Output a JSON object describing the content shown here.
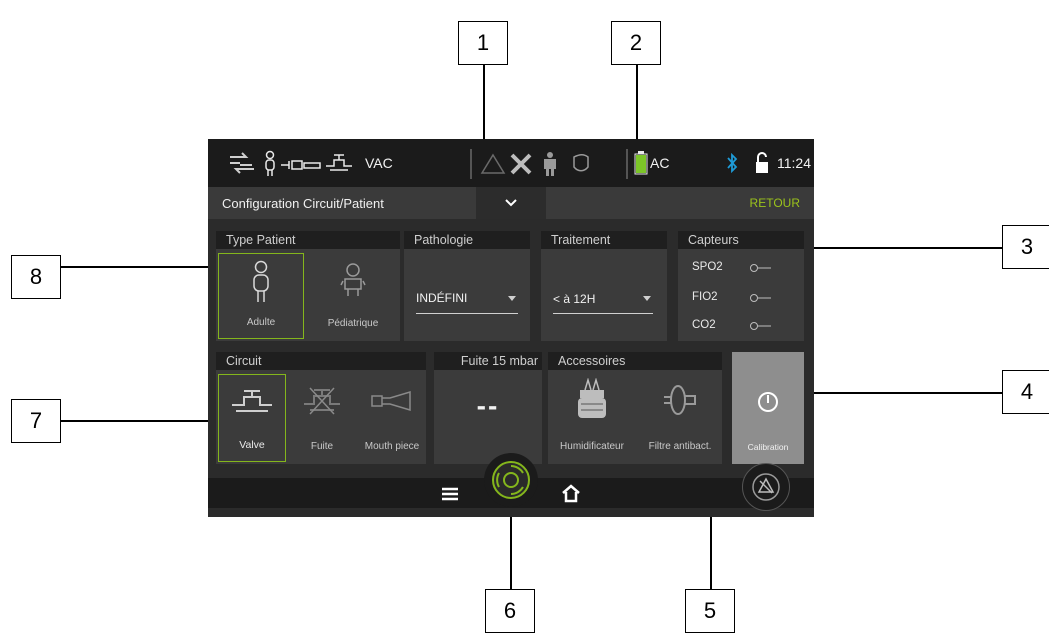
{
  "callouts": [
    "1",
    "2",
    "3",
    "4",
    "5",
    "6",
    "7",
    "8"
  ],
  "statusbar": {
    "mode_label": "VAC",
    "power_label": "AC",
    "time": "11:24",
    "icons": [
      "ventilation-mode-icon",
      "patient-icon",
      "circuit-icon",
      "valve-icon",
      "alarm-icon",
      "tools-icon",
      "person-icon",
      "mask-icon",
      "battery-icon",
      "bluetooth-icon",
      "lock-icon"
    ]
  },
  "header": {
    "title": "Configuration Circuit/Patient",
    "back_label": "RETOUR"
  },
  "patient_type": {
    "title": "Type Patient",
    "options": [
      {
        "label": "Adulte",
        "icon": "adult-icon",
        "selected": true
      },
      {
        "label": "Pédiatrique",
        "icon": "baby-icon",
        "selected": false
      }
    ]
  },
  "pathology": {
    "title": "Pathologie",
    "value": "INDÉFINI"
  },
  "treatment": {
    "title": "Traitement",
    "value": "< à 12H"
  },
  "sensors": {
    "title": "Capteurs",
    "items": [
      {
        "label": "SPO2",
        "on": false
      },
      {
        "label": "FIO2",
        "on": false
      },
      {
        "label": "CO2",
        "on": false
      }
    ]
  },
  "circuit": {
    "title": "Circuit",
    "options": [
      {
        "label": "Valve",
        "icon": "valve-circuit-icon",
        "selected": true
      },
      {
        "label": "Fuite",
        "icon": "leak-circuit-icon",
        "selected": false
      },
      {
        "label": "Mouth piece",
        "icon": "mouth-piece-icon",
        "selected": false
      }
    ]
  },
  "leak": {
    "title": "Fuite 15 mbar",
    "value": "--"
  },
  "accessories": {
    "title": "Accessoires",
    "items": [
      {
        "label": "Humidificateur",
        "icon": "humidifier-icon"
      },
      {
        "label": "Filtre antibact.",
        "icon": "filter-icon"
      }
    ]
  },
  "calibration": {
    "label": "Calibration",
    "icon": "calibration-icon"
  },
  "bottombar": {
    "icons": [
      "menu-icon",
      "ventilation-start-icon",
      "home-icon",
      "alarm-silence-icon"
    ]
  },
  "colors": {
    "accent": "#84b61c",
    "back": "#9bc31c",
    "bluetooth": "#1e9bd7",
    "battery": "#7cc628"
  }
}
